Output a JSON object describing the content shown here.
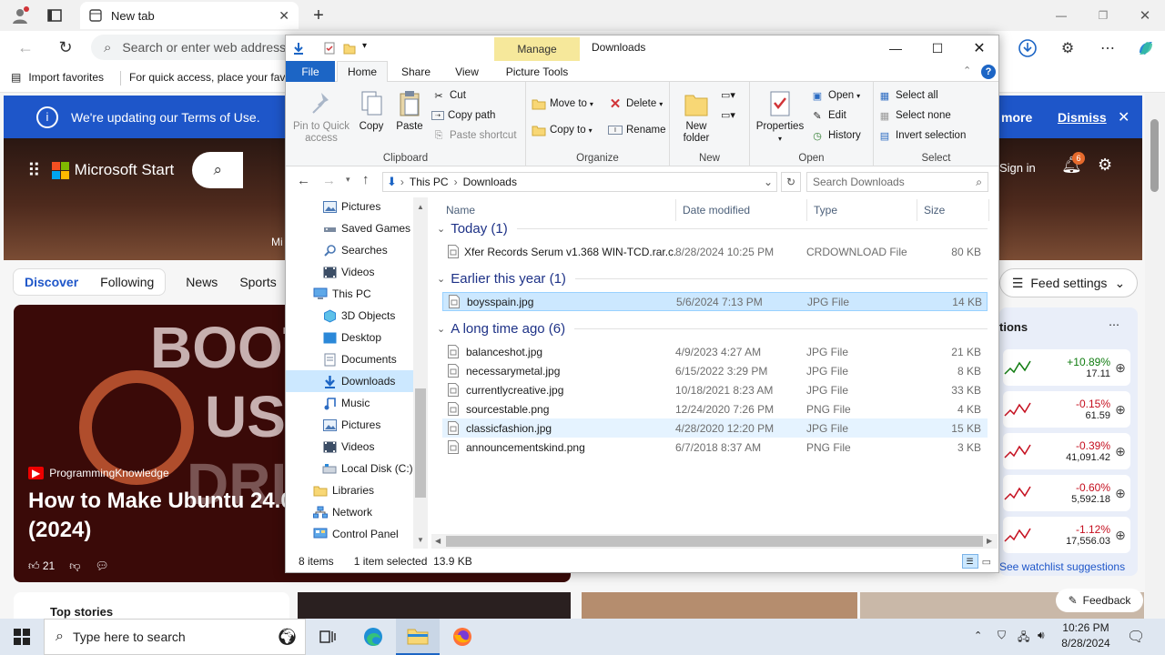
{
  "browser": {
    "tab_title": "New tab",
    "omnibox_placeholder": "Search or enter web address",
    "favorites": {
      "import_label": "Import favorites",
      "hint": "For quick access, place your favo"
    }
  },
  "msn": {
    "notice_text": "We're updating our Terms of Use.",
    "notice_more": "more",
    "notice_dismiss": "Dismiss",
    "brand": "Microsoft Start",
    "sign_in": "Sign in",
    "notif_count": "6",
    "nav": [
      "Discover",
      "Following",
      "News",
      "Sports"
    ],
    "hero_text": "Mi",
    "video": {
      "big_text": "BOOTA",
      "big_text2": "US",
      "big_text3": "DRIV",
      "source": "ProgrammingKnowledge",
      "title": "How to Make Ubuntu 24.0",
      "title2": "(2024)",
      "likes": "21"
    },
    "feed_settings": "Feed settings",
    "panel_title": "tions",
    "stocks": [
      {
        "pct": "+10.89%",
        "val": "17.11",
        "color": "#107c10"
      },
      {
        "pct": "-0.15%",
        "val": "61.59",
        "color": "#c50f1f"
      },
      {
        "pct": "-0.39%",
        "val": "41,091.42",
        "color": "#c50f1f"
      },
      {
        "pct": "-0.60%",
        "val": "5,592.18",
        "color": "#c50f1f"
      },
      {
        "pct": "-1.12%",
        "val": "17,556.03",
        "color": "#c50f1f"
      }
    ],
    "watchlist": "See watchlist suggestions",
    "top_stories": "Top stories",
    "feedback": "Feedback"
  },
  "explorer": {
    "manage_tab": "Manage",
    "title": "Downloads",
    "ribbon_tabs": [
      "File",
      "Home",
      "Share",
      "View",
      "Picture Tools"
    ],
    "clipboard": {
      "pin": "Pin to Quick access",
      "copy": "Copy",
      "paste": "Paste",
      "cut": "Cut",
      "copy_path": "Copy path",
      "paste_shortcut": "Paste shortcut",
      "label": "Clipboard"
    },
    "organize": {
      "move_to": "Move to",
      "copy_to": "Copy to",
      "delete": "Delete",
      "rename": "Rename",
      "label": "Organize"
    },
    "new": {
      "new_folder": "New folder",
      "label": "New"
    },
    "open": {
      "properties": "Properties",
      "open": "Open",
      "edit": "Edit",
      "history": "History",
      "label": "Open"
    },
    "select": {
      "select_all": "Select all",
      "select_none": "Select none",
      "invert": "Invert selection",
      "label": "Select"
    },
    "path": [
      "This PC",
      "Downloads"
    ],
    "search_placeholder": "Search Downloads",
    "nav_items": [
      {
        "label": "Pictures",
        "icon": "pictures-icon",
        "indent": 1
      },
      {
        "label": "Saved Games",
        "icon": "saved-games-icon",
        "indent": 1
      },
      {
        "label": "Searches",
        "icon": "searches-icon",
        "indent": 1
      },
      {
        "label": "Videos",
        "icon": "videos-icon",
        "indent": 1
      },
      {
        "label": "This PC",
        "icon": "this-pc-icon",
        "indent": 0
      },
      {
        "label": "3D Objects",
        "icon": "3d-objects-icon",
        "indent": 1
      },
      {
        "label": "Desktop",
        "icon": "desktop-icon",
        "indent": 1
      },
      {
        "label": "Documents",
        "icon": "documents-icon",
        "indent": 1
      },
      {
        "label": "Downloads",
        "icon": "downloads-icon",
        "indent": 1
      },
      {
        "label": "Music",
        "icon": "music-icon",
        "indent": 1
      },
      {
        "label": "Pictures",
        "icon": "pictures-icon",
        "indent": 1
      },
      {
        "label": "Videos",
        "icon": "videos-icon",
        "indent": 1
      },
      {
        "label": "Local Disk (C:)",
        "icon": "local-disk-icon",
        "indent": 1
      },
      {
        "label": "Libraries",
        "icon": "libraries-icon",
        "indent": 0
      },
      {
        "label": "Network",
        "icon": "network-icon",
        "indent": 0
      },
      {
        "label": "Control Panel",
        "icon": "control-panel-icon",
        "indent": 0
      }
    ],
    "columns": [
      "Name",
      "Date modified",
      "Type",
      "Size"
    ],
    "groups": [
      {
        "label": "Today (1)",
        "files": [
          {
            "name": "Xfer Records Serum v1.368 WIN-TCD.rar.c...",
            "date": "8/28/2024 10:25 PM",
            "type": "CRDOWNLOAD File",
            "size": "80 KB"
          }
        ]
      },
      {
        "label": "Earlier this year (1)",
        "files": [
          {
            "name": "boysspain.jpg",
            "date": "5/6/2024 7:13 PM",
            "type": "JPG File",
            "size": "14 KB"
          }
        ]
      },
      {
        "label": "A long time ago (6)",
        "files": [
          {
            "name": "balanceshot.jpg",
            "date": "4/9/2023 4:27 AM",
            "type": "JPG File",
            "size": "21 KB"
          },
          {
            "name": "necessarymetal.jpg",
            "date": "6/15/2022 3:29 PM",
            "type": "JPG File",
            "size": "8 KB"
          },
          {
            "name": "currentlycreative.jpg",
            "date": "10/18/2021 8:23 AM",
            "type": "JPG File",
            "size": "33 KB"
          },
          {
            "name": "sourcestable.png",
            "date": "12/24/2020 7:26 PM",
            "type": "PNG File",
            "size": "4 KB"
          },
          {
            "name": "classicfashion.jpg",
            "date": "4/28/2020 12:20 PM",
            "type": "JPG File",
            "size": "15 KB"
          },
          {
            "name": "announcementskind.png",
            "date": "6/7/2018 8:37 AM",
            "type": "PNG File",
            "size": "3 KB"
          }
        ]
      }
    ],
    "status": {
      "items": "8 items",
      "selected": "1 item selected  13.9 KB"
    }
  },
  "taskbar": {
    "search_placeholder": "Type here to search",
    "time": "10:26 PM",
    "date": "8/28/2024"
  },
  "colors": {
    "accent": "#1c65c5",
    "selection": "#cce8ff",
    "msn_blue": "#1e56c9"
  }
}
